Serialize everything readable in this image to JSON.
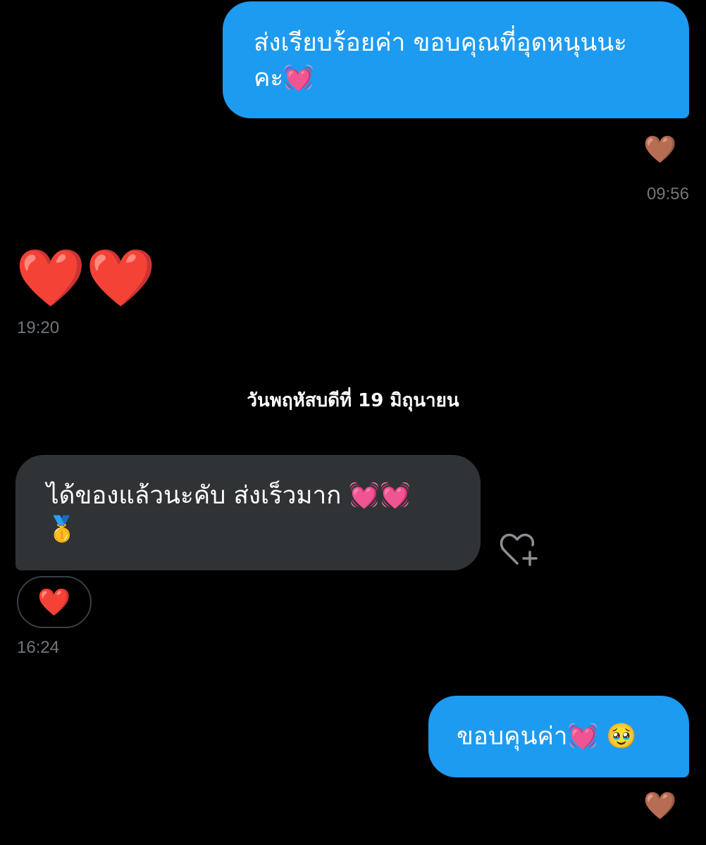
{
  "messages": [
    {
      "id": "m1",
      "direction": "outgoing",
      "text_line1": "ส่งเรียบร้อยค่า ขอบคุณที่อุดหนุนนะ",
      "text_line2": "คะ💓",
      "reaction": "🤎",
      "time": "09:56"
    },
    {
      "id": "m2",
      "direction": "incoming",
      "emoji_text": "❤️❤️",
      "time": "19:20"
    },
    {
      "id": "m3",
      "direction": "incoming",
      "text_line1": "ได้ของแล้วนะคับ ส่งเร็วมาก 💓💓",
      "text_line2": "🥇",
      "reaction": "❤️",
      "time": "16:24"
    },
    {
      "id": "m4",
      "direction": "outgoing",
      "text_line1": "ขอบคุนค่า💓 🥹",
      "reaction": "🤎"
    }
  ],
  "date_separator": "วันพฤหัสบดีที่ 19 มิถุนายน",
  "colors": {
    "background": "#000000",
    "outgoing_bubble": "#1d9bf0",
    "incoming_bubble": "#2f3336",
    "timestamp": "#71767b"
  },
  "icons": {
    "add_reaction": "heart-plus-icon"
  }
}
